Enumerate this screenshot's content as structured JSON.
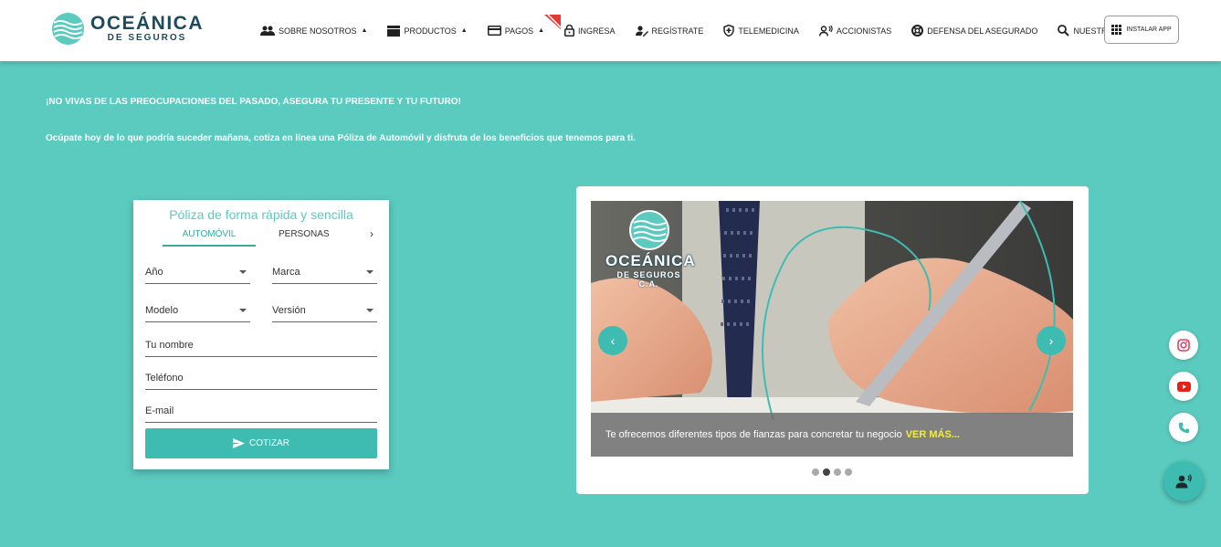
{
  "header": {
    "brand": "OCEÁNICA",
    "brand_sub": "DE SEGUROS",
    "nav": [
      {
        "label": "SOBRE NOSOTROS",
        "icon": "people-icon",
        "caret": "▲"
      },
      {
        "label": "PRODUCTOS",
        "icon": "cards-icon",
        "caret": "▲"
      },
      {
        "label": "PAGOS",
        "icon": "credit-card-icon",
        "caret": "▲"
      },
      {
        "label": "INGRESA",
        "icon": "lock-icon"
      },
      {
        "label": "REGÍSTRATE",
        "icon": "user-edit-icon"
      },
      {
        "label": "TELEMEDICINA",
        "icon": "shield-icon"
      },
      {
        "label": "ACCIONISTAS",
        "icon": "shareholders-icon"
      },
      {
        "label": "DEFENSA DEL ASEGURADO",
        "icon": "lifebuoy-icon"
      },
      {
        "label": "NUESTROS ALIADOS",
        "icon": "search-icon"
      }
    ],
    "install_label": "INSTALAR APP"
  },
  "hero": {
    "line1": "¡NO VIVAS DE LAS PREOCUPACIONES DEL PASADO, ASEGURA TU PRESENTE Y TU FUTURO!",
    "line2": "Ocúpate hoy de lo que podría suceder mañana, cotiza en línea una Póliza de Automóvil y disfruta de los beneficios que tenemos para ti."
  },
  "form": {
    "title": "Póliza de forma rápida y sencilla",
    "tabs": [
      "AUTOMÓVIL",
      "PERSONAS"
    ],
    "next_arrow": "›",
    "fields": {
      "year": "Año",
      "brand": "Marca",
      "model": "Modelo",
      "version": "Versión",
      "name": "Tu nombre",
      "phone": "Teléfono",
      "email": "E-mail"
    },
    "submit": "COTIZAR"
  },
  "carousel": {
    "caption": "Te ofrecemos diferentes tipos de fianzas para concretar tu negocio",
    "more": "VER MÁS...",
    "slide_brand": "OCEÁNICA",
    "slide_brand_sub": "DE SEGUROS C.A.",
    "prev": "‹",
    "next": "›",
    "dot_count": 4,
    "active_dot": 1
  },
  "colors": {
    "background": "#5bcabf",
    "accent": "#3fbcb1",
    "highlight": "#f2ee3a",
    "brand_dark": "#1d4b5c",
    "instagram": "#e4405f",
    "youtube": "#e62117"
  },
  "social": [
    "instagram-icon",
    "youtube-icon",
    "phone-icon"
  ],
  "support_icon": "support-agent-icon"
}
